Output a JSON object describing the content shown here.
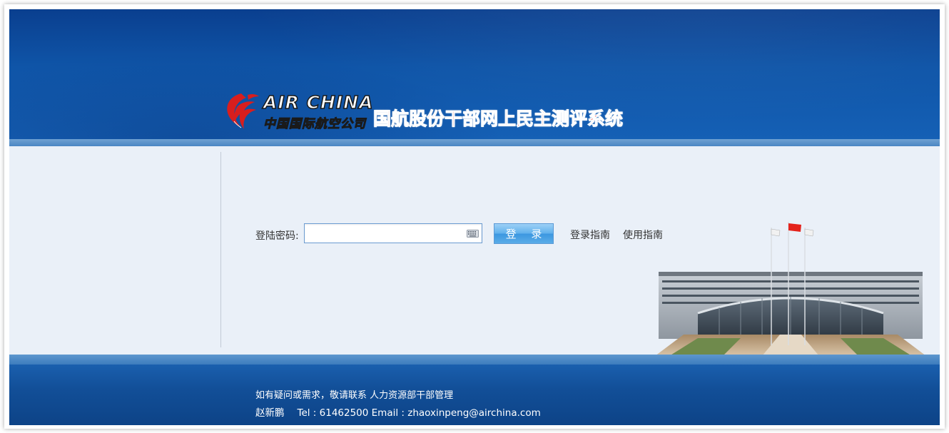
{
  "header": {
    "brand_en": "AIR CHINA",
    "brand_cn": "中国国际航空公司",
    "system_title": "国航股份干部网上民主测评系统",
    "logo_icon": "phoenix-logo-icon",
    "title_color": "#e8231f",
    "bg_color": "#0f55a8"
  },
  "login": {
    "password_label": "登陆密码:",
    "password_value": "",
    "keyboard_icon": "keyboard-icon",
    "login_button": "登 录",
    "guide_links": [
      "登录指南",
      "使用指南"
    ]
  },
  "illustration": {
    "icon": "headquarters-building-image"
  },
  "footer": {
    "contact_line": "如有疑问或需求，敬请联系 人力资源部干部管理",
    "contact_name": "赵新鹏",
    "contact_details": "Tel : 61462500 Email : zhaoxinpeng@airchina.com"
  }
}
